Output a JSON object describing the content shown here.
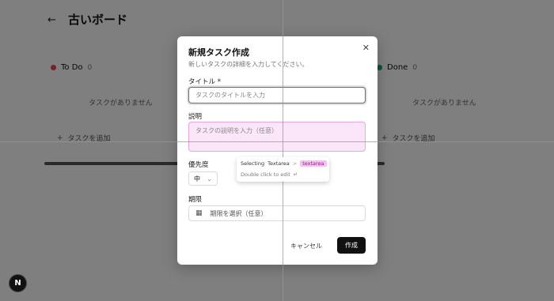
{
  "board": {
    "back_icon": "←",
    "title": "古いボード",
    "columns": [
      {
        "name": "To Do",
        "count": "0",
        "empty": "タスクがありません",
        "add": "タスクを追加",
        "color": "#e5484d"
      },
      {
        "name": "Done",
        "count": "0",
        "empty": "タスクがありません",
        "add": "タスクを追加",
        "color": "#22a06b"
      }
    ],
    "add_icon": "+"
  },
  "modal": {
    "title": "新規タスク作成",
    "description": "新しいタスクの詳細を入力してください。",
    "close_icon": "✕",
    "title_label": "タイトル *",
    "title_placeholder": "タスクのタイトルを入力",
    "desc_label": "説明",
    "desc_placeholder": "タスクの説明を入力（任意）",
    "priority_label": "優先度",
    "priority_value": "中",
    "priority_icon": "⌄",
    "due_label": "期限",
    "due_placeholder": "期限を選択（任意）",
    "calendar_icon": "▦",
    "cancel": "キャンセル",
    "create": "作成"
  },
  "tooltip": {
    "selecting": "Selecting",
    "element": "Textarea",
    "arrow": ">",
    "tag": "textarea",
    "hint": "Double click to edit",
    "enter_icon": "↵"
  },
  "nextjs_badge": "N"
}
